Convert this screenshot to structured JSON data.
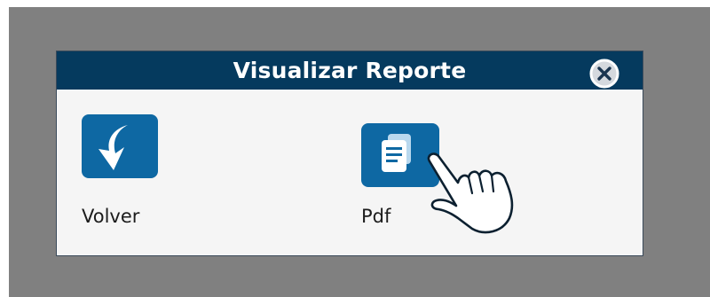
{
  "dialog": {
    "title": "Visualizar Reporte",
    "close_icon": "close-circle-icon"
  },
  "actions": [
    {
      "label": "Volver",
      "icon": "back-arrow-icon"
    },
    {
      "label": "Pdf",
      "icon": "document-icon"
    }
  ],
  "cursor": {
    "icon": "hand-pointer-icon"
  },
  "colors": {
    "header_bg": "#053a5e",
    "button_bg": "#0e68a3",
    "backdrop": "#808080",
    "dialog_bg": "#f5f5f5"
  }
}
